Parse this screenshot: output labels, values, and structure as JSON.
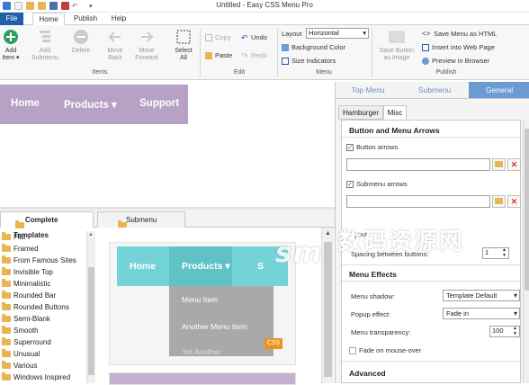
{
  "window": {
    "title": "Untitled - Easy CSS Menu Pro"
  },
  "ribbon_tabs": [
    "File",
    "Home",
    "Publish",
    "Help"
  ],
  "items_group": {
    "label": "Items",
    "buttons": [
      "Add Item ▾",
      "Add Submenu",
      "Delete",
      "Move Back",
      "Move Forward",
      "Select All"
    ]
  },
  "edit_group": {
    "label": "Edit",
    "copy": "Copy",
    "paste": "Paste",
    "undo": "Undo",
    "redo": "Redo"
  },
  "menu_group": {
    "label": "Menu",
    "layout_label": "Layout",
    "layout_value": "Horizontal",
    "background_color": "Background Color",
    "size_indicators": "Size Indicators"
  },
  "publish_group": {
    "label": "Publish",
    "save_image": "Save Button as Image",
    "save_html": "Save Menu as HTML",
    "insert_web": "Insert into Web Page",
    "preview_browser": "Preview in Browser"
  },
  "canvas_menu": {
    "items": [
      "Home",
      "Products ▾",
      "Support"
    ],
    "color": "#b7a1c4"
  },
  "template_tabs": [
    "Complete Templates",
    "Submenu Templates"
  ],
  "template_list": [
    "Flat",
    "Framed",
    "From Famous Sites",
    "Invisible Top",
    "Minimalistic",
    "Rounded Bar",
    "Rounded Buttons",
    "Semi-Blank",
    "Smooth",
    "Superround",
    "Unusual",
    "Various",
    "Windows Inspired"
  ],
  "preview_menu": {
    "items": [
      "Home",
      "Products ▾",
      "S"
    ],
    "submenu": [
      "Menu Item",
      "Another Menu Item",
      "Yet Another"
    ],
    "badge": "CSS"
  },
  "panel_tabs": [
    "Top Menu",
    "Submenu",
    "General"
  ],
  "panel_subtabs": [
    "Hamburger",
    "Misc"
  ],
  "arrows_section": {
    "title": "Button and Menu Arrows",
    "button_arrows": "Button arrows",
    "submenu_arrows": "Submenu arrows",
    "spacing_label": "Spacing between buttons:",
    "spacing_value": "1",
    "layout_fragment": "yout"
  },
  "effects_section": {
    "title": "Menu Effects",
    "shadow_label": "Menu shadow:",
    "shadow_value": "Template Default",
    "popup_label": "Popup effect:",
    "popup_value": "Fade in",
    "transparency_label": "Menu transparency:",
    "transparency_value": "100",
    "fade_label": "Fade on mouse-over"
  },
  "advanced_section": {
    "title": "Advanced"
  },
  "watermark": {
    "text": "数码资源网",
    "latin": "sm"
  }
}
